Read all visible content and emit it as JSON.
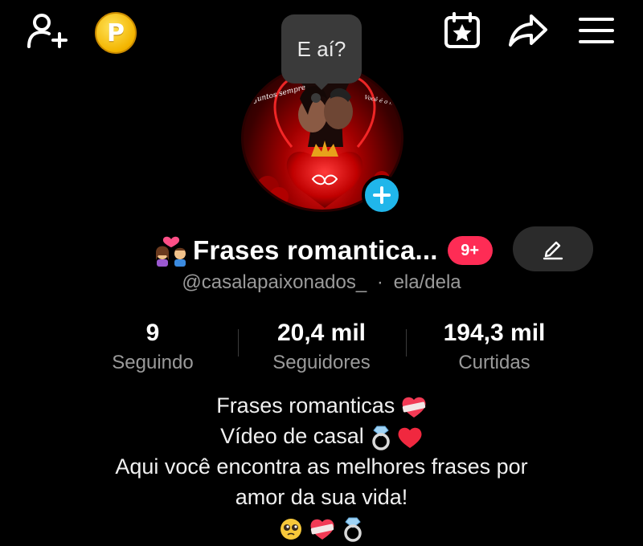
{
  "header": {
    "icons": [
      "add-user-icon",
      "coin-icon",
      "calendar-star-icon",
      "share-icon",
      "menu-icon"
    ],
    "coin_letter": "P"
  },
  "bubble": {
    "text": "E aí?"
  },
  "profile": {
    "display_name": "Frases romantica...",
    "notification_badge": "9+",
    "handle": "@casalapaixonados_",
    "separator": "·",
    "pronouns": "ela/dela"
  },
  "stats": [
    {
      "value": "9",
      "label": "Seguindo"
    },
    {
      "value": "20,4 mil",
      "label": "Seguidores"
    },
    {
      "value": "194,3 mil",
      "label": "Curtidas"
    }
  ],
  "bio": {
    "line1": "Frases romanticas",
    "line2": "Vídeo de casal",
    "line3": "Aqui você encontra as melhores frases por",
    "line4": "amor da sua vida!"
  },
  "avatar": {
    "text_left": "Juntos sempre",
    "text_right": "Você é o meu porto seguro",
    "colors": {
      "primary": "#d10000",
      "glow": "#ff1a1a"
    }
  },
  "colors": {
    "background": "#000000",
    "badge": "#fe2c55",
    "add_avatar": "#20b6ea",
    "muted_text": "#9a9a9a",
    "coin": "#f3b500"
  }
}
